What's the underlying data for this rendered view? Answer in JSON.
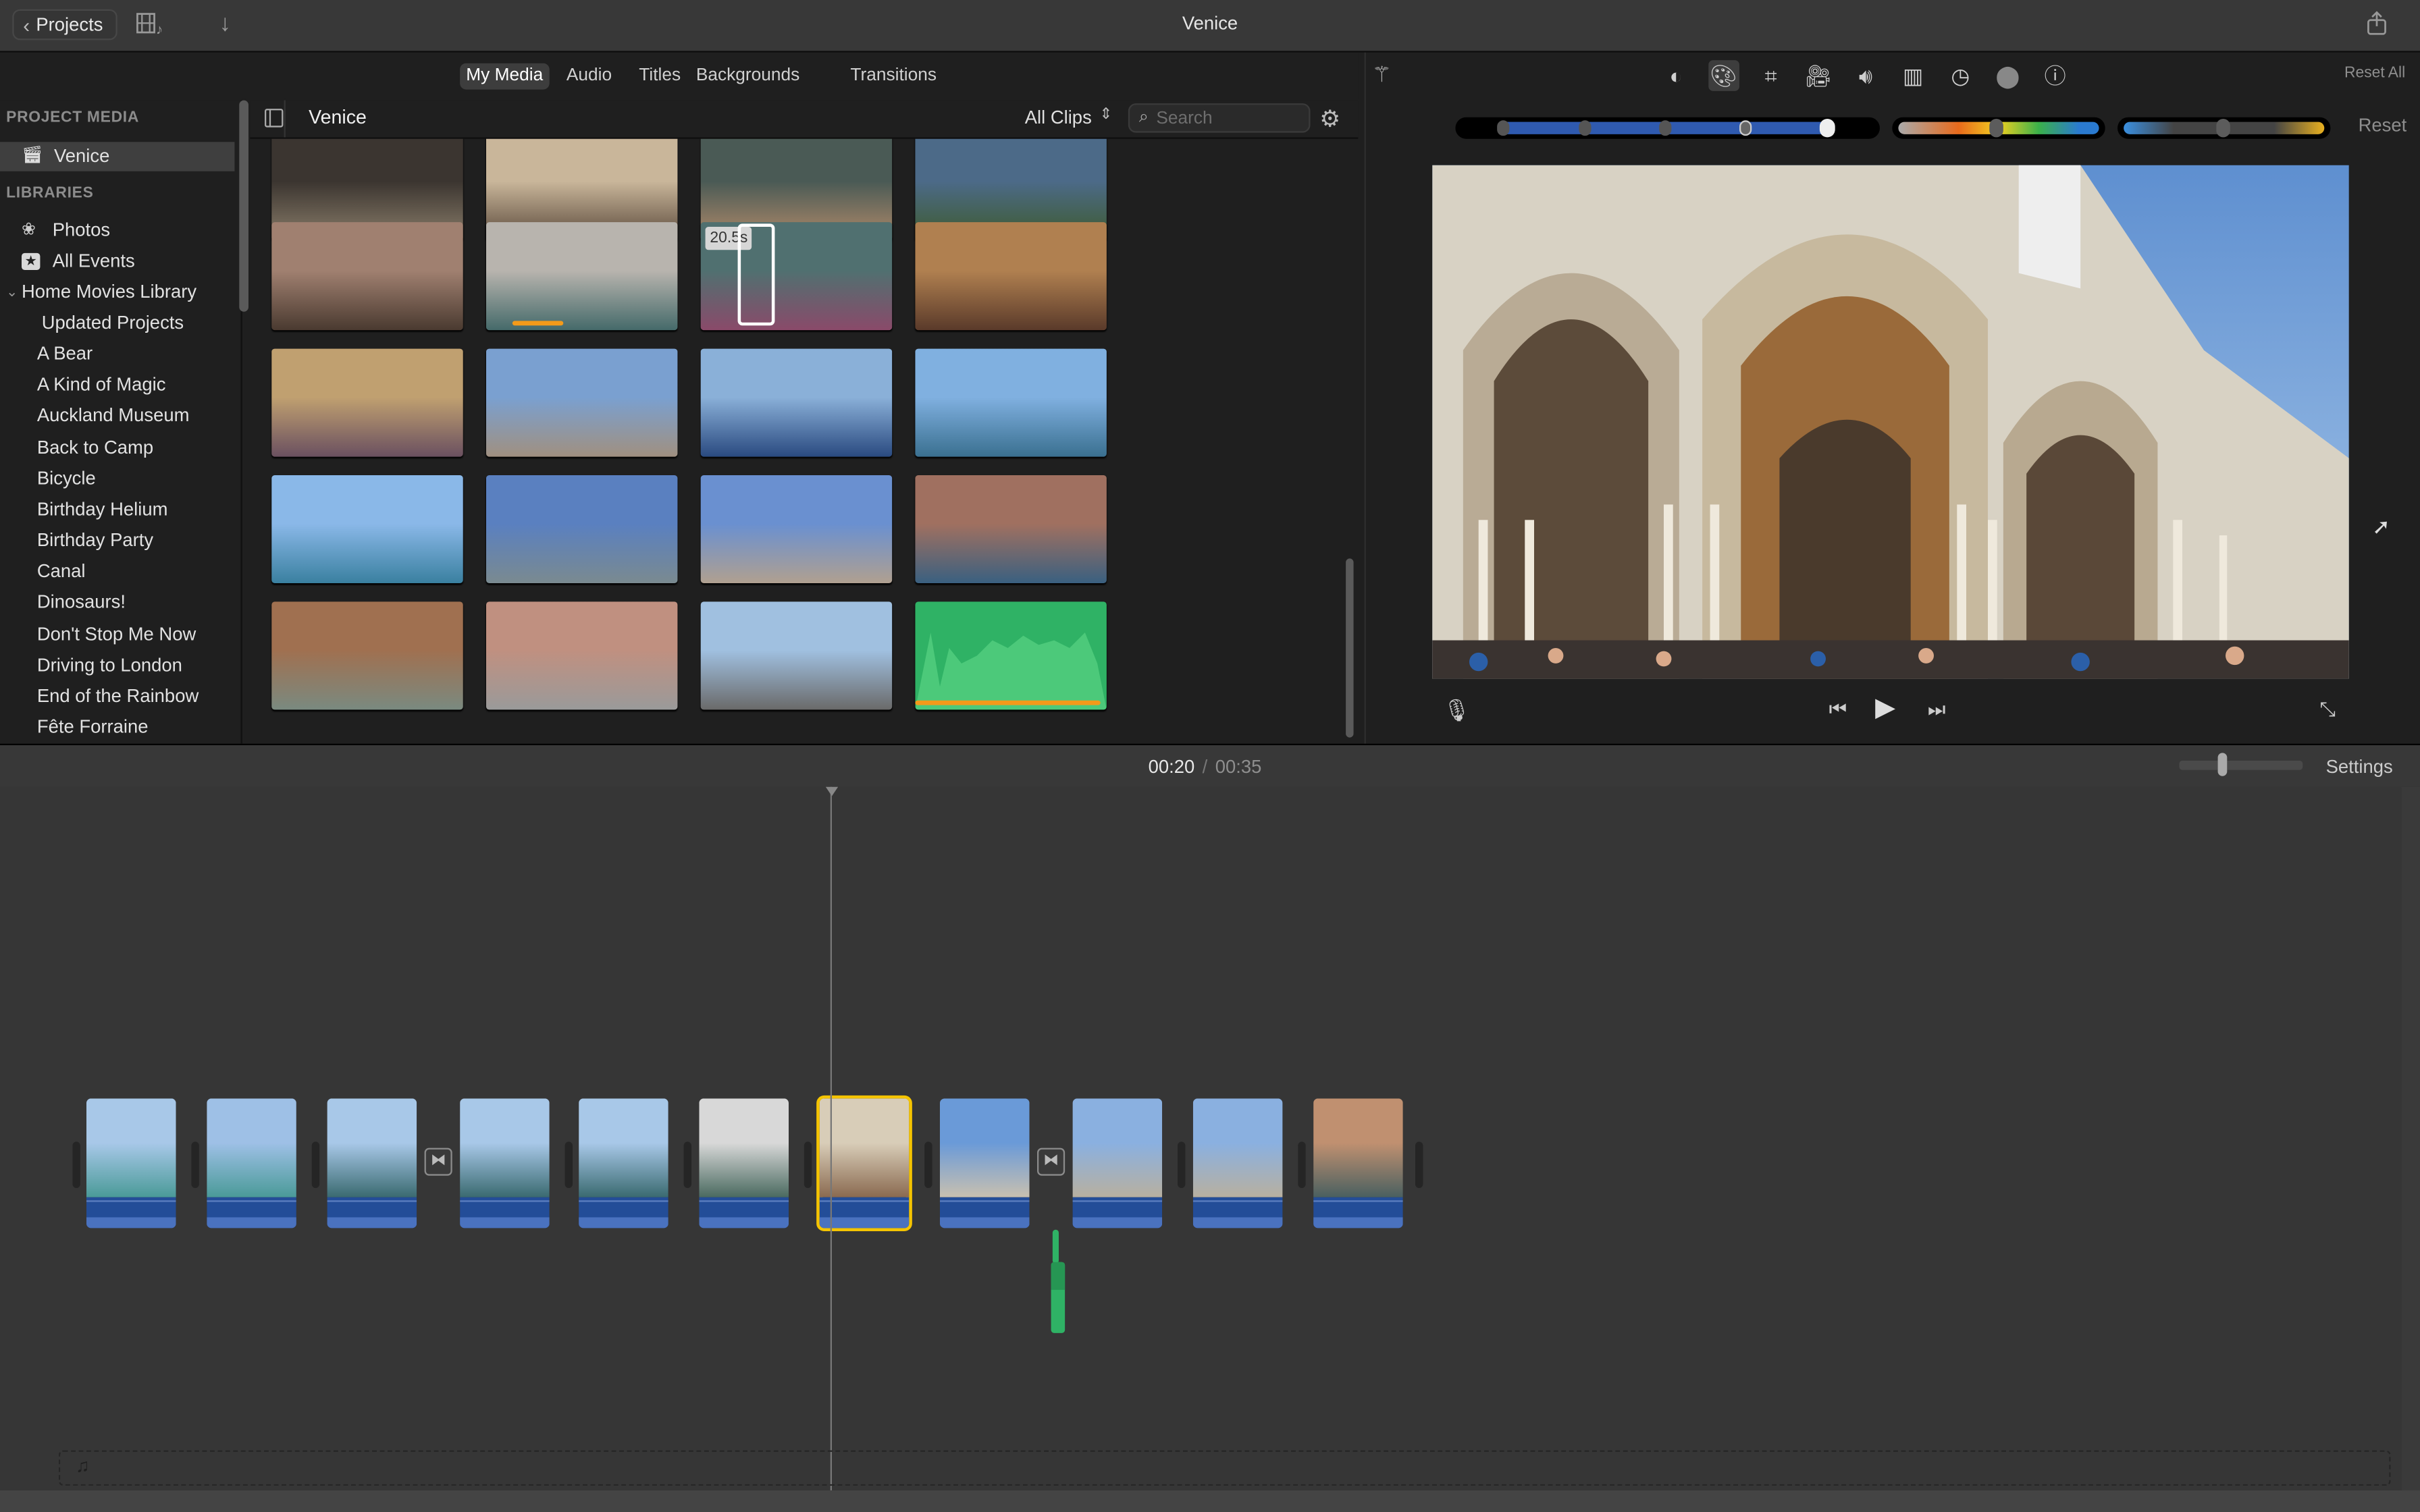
{
  "window": {
    "title": "Venice"
  },
  "toolbar": {
    "projects_label": "Projects",
    "media_import_icon": "film-music-icon",
    "import_icon": "down-arrow-icon",
    "share_icon": "share-icon"
  },
  "browser": {
    "tabs": [
      {
        "label": "My Media",
        "active": true
      },
      {
        "label": "Audio",
        "active": false
      },
      {
        "label": "Titles",
        "active": false
      },
      {
        "label": "Backgrounds",
        "active": false
      },
      {
        "label": "Transitions",
        "active": false
      }
    ],
    "event_title": "Venice",
    "filter": "All Clips",
    "search_placeholder": "Search",
    "hover_duration": "20.5s"
  },
  "sidebar": {
    "project_media_header": "PROJECT MEDIA",
    "project_media_item": "Venice",
    "libraries_header": "LIBRARIES",
    "photos": "Photos",
    "all_events": "All Events",
    "library_name": "Home Movies Library",
    "events": [
      "Updated Projects",
      "A Bear",
      "A Kind of Magic",
      "Auckland Museum",
      "Back to Camp",
      "Bicycle",
      "Birthday Helium",
      "Birthday Party",
      "Canal",
      "Dinosaurs!",
      "Don't Stop Me Now",
      "Driving to London",
      "End of the Rainbow",
      "Fête Forraine"
    ]
  },
  "viewer": {
    "reset_all": "Reset All",
    "reset": "Reset",
    "tools": [
      "color-balance-icon",
      "color-correction-icon",
      "crop-icon",
      "stabilization-icon",
      "volume-icon",
      "noise-reduction-icon",
      "speed-icon",
      "clip-filter-icon",
      "info-icon"
    ],
    "active_tool": "color-correction-icon"
  },
  "timeline": {
    "current_time": "00:20",
    "separator": "/",
    "total_time": "00:35",
    "settings": "Settings",
    "clip_zoom_level": 0.2,
    "clips": 11,
    "selected_clip": 7
  },
  "colors": {
    "selection": "#f5c400",
    "audio": "#234d98",
    "music": "#2fb265",
    "used_marker": "#f39a1a"
  }
}
